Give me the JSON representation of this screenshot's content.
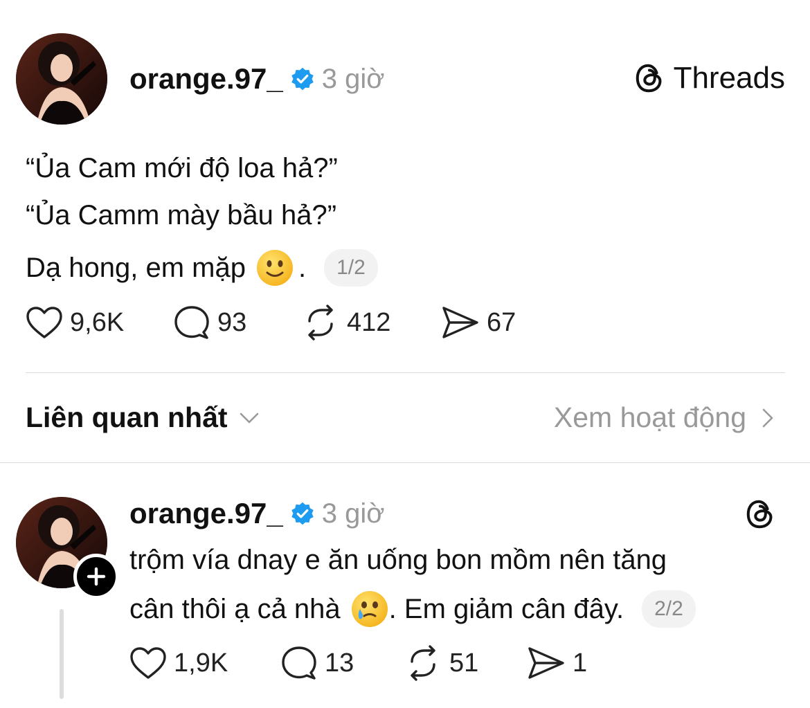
{
  "brand": {
    "name": "Threads"
  },
  "post1": {
    "username": "orange.97_",
    "time": "3 giờ",
    "lines": [
      "“Ủa Cam mới độ loa hả?”",
      "“Ủa Camm mày bầu hả?”",
      "Dạ hong, em mặp",
      "."
    ],
    "emoji": "slightly-smiling-face",
    "page": "1/2",
    "likes": "9,6K",
    "comments": "93",
    "reposts": "412",
    "shares": "67"
  },
  "sort": {
    "label": "Liên quan nhất",
    "activity": "Xem hoạt động"
  },
  "post2": {
    "username": "orange.97_",
    "time": "3 giờ",
    "line1": "trộm vía dnay e ăn uống bon mồm nên tăng",
    "line2a": "cân thôi ạ cả nhà",
    "line2b": ". Em giảm cân đây.",
    "emoji": "face-holding-back-tears",
    "page": "2/2",
    "likes": "1,9K",
    "comments": "13",
    "reposts": "51",
    "shares": "1"
  },
  "colors": {
    "verified": "#1d9bf0",
    "muted": "#999999",
    "divider": "#dadada"
  }
}
